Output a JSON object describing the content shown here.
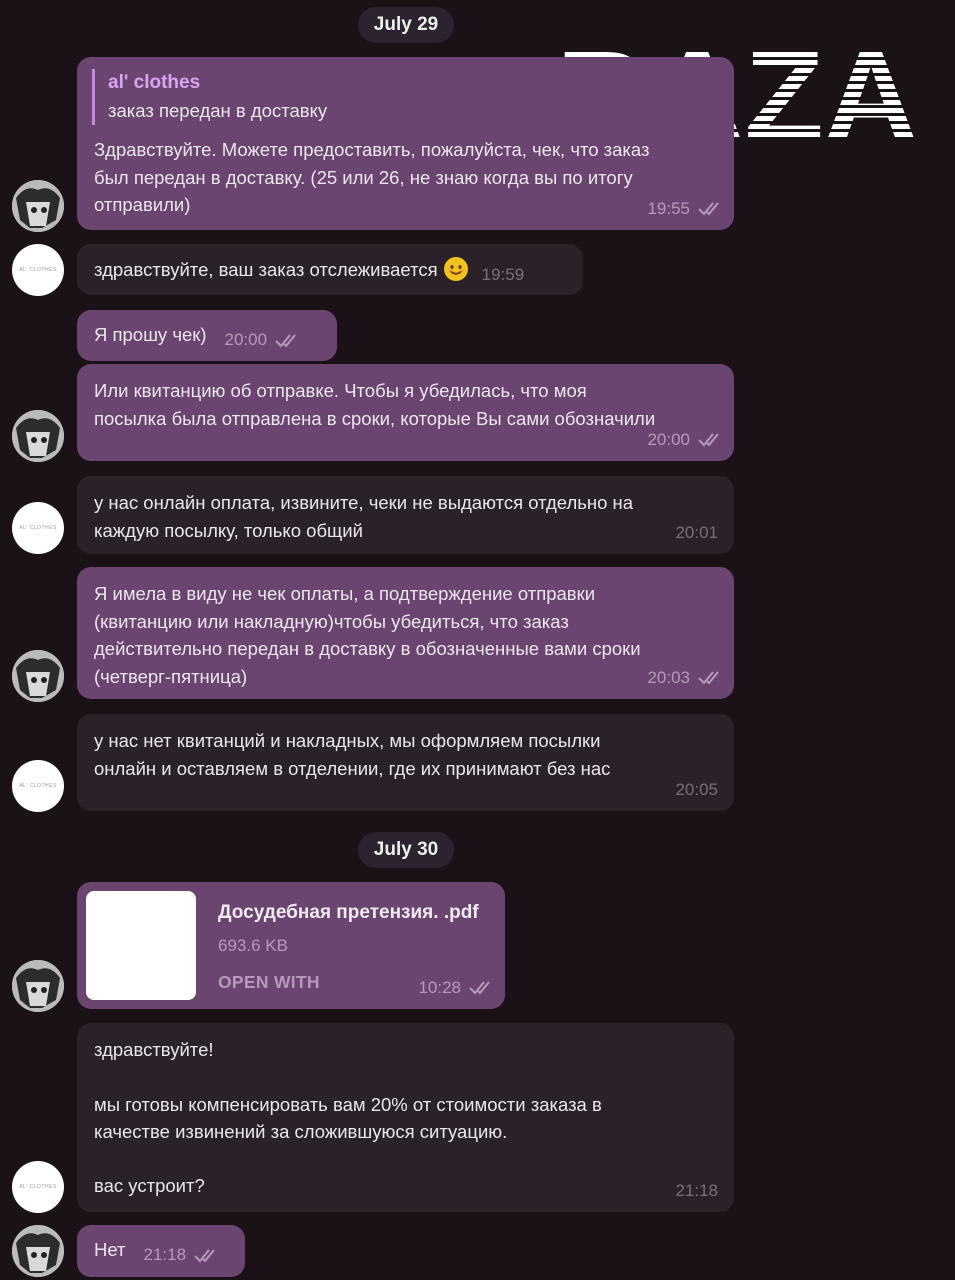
{
  "watermark": {
    "text": "BAZA",
    "color": "#ffffff"
  },
  "colors": {
    "background": "#1b1218",
    "outgoing_bubble": "#6a4570",
    "incoming_bubble": "#2b2229",
    "accent": "#d7a6f2"
  },
  "dates": [
    "July 29",
    "July 30"
  ],
  "shop_avatar_text": "AL' CLOTHES",
  "messages": [
    {
      "dir": "out",
      "reply_to": {
        "name": "al' clothes",
        "text": "заказ передан в доставку"
      },
      "text": "Здравствуйте. Можете предоставить, пожалуйста, чек, что заказ\nбыл передан в доставку. (25 или 26, не знаю когда вы по итогу\nотправили)",
      "time": "19:55",
      "ticks": "double-check-icon"
    },
    {
      "dir": "in",
      "text": "здравствуйте, ваш заказ отслеживается",
      "emoji": "smiling-face-emoji",
      "time": "19:59"
    },
    {
      "dir": "out",
      "text": "Я прошу чек)",
      "time": "20:00",
      "ticks": "double-check-icon"
    },
    {
      "dir": "out",
      "text": "Или квитанцию об отправке. Чтобы я убедилась, что моя\nпосылка была отправлена в сроки, которые Вы сами обозначили",
      "time": "20:00",
      "ticks": "double-check-icon"
    },
    {
      "dir": "in",
      "text": "у нас онлайн оплата, извините, чеки не выдаются отдельно на\nкаждую посылку, только общий",
      "time": "20:01"
    },
    {
      "dir": "out",
      "text": "Я имела в виду не чек оплаты, а подтверждение отправки\n(квитанцию или накладную)чтобы убедиться, что заказ\nдействительно передан в доставку в обозначенные вами сроки\n(четверг-пятница)",
      "time": "20:03",
      "ticks": "double-check-icon"
    },
    {
      "dir": "in",
      "text": "у нас нет квитанций и накладных, мы оформляем посылки\nонлайн и оставляем в отделении, где их принимают без нас",
      "time": "20:05"
    },
    {
      "dir": "out",
      "file": {
        "name": "Досудебная претензия. .pdf",
        "size": "693.6 KB",
        "action": "OPEN WITH"
      },
      "time": "10:28",
      "ticks": "double-check-icon"
    },
    {
      "dir": "in",
      "text": "здравствуйте!\n\nмы готовы компенсировать вам 20% от стоимости заказа в\nкачестве извинений за сложившуюся ситуацию.\n\nвас устроит?",
      "time": "21:18"
    },
    {
      "dir": "out",
      "text": "Нет",
      "time": "21:18",
      "ticks": "double-check-icon"
    }
  ]
}
